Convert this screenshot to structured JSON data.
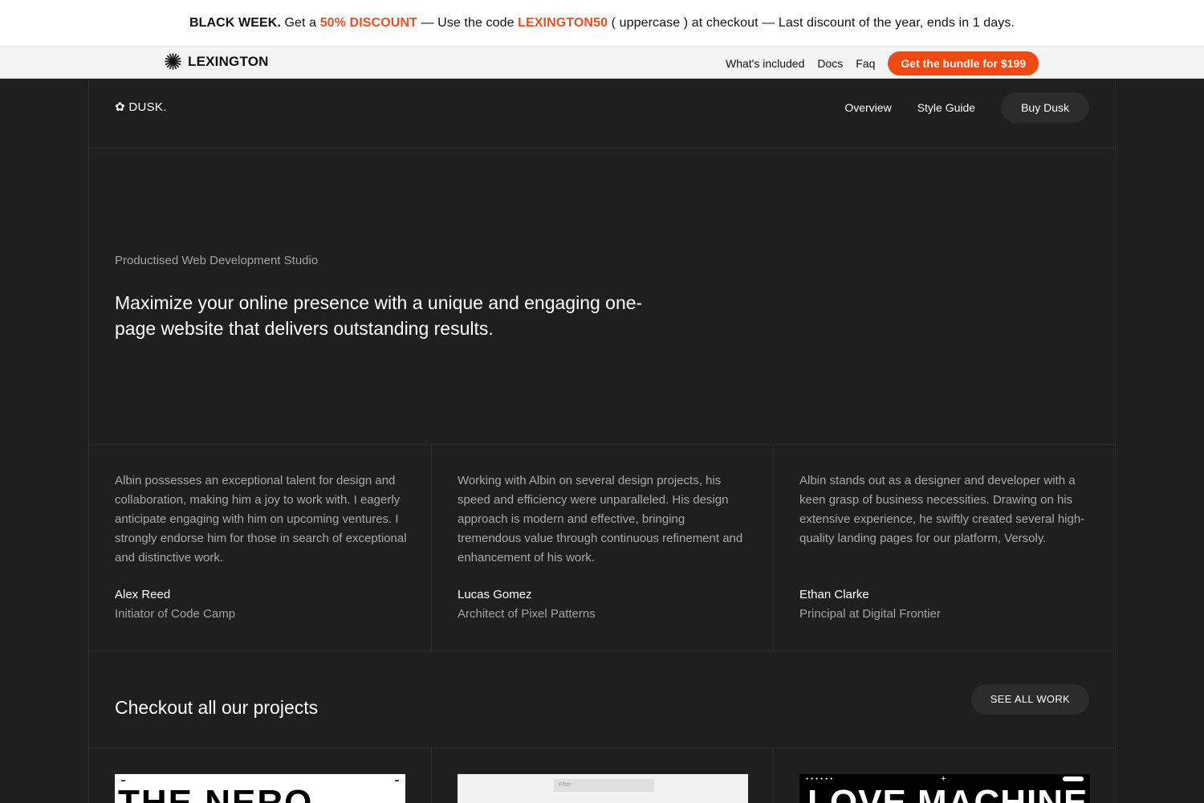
{
  "promo": {
    "lead": "BLACK WEEK.",
    "t1": " Get a ",
    "discount": "50% DISCOUNT",
    "t2": " — Use the code ",
    "code": "LEXINGTON50",
    "t3": " ( uppercase ) at checkout — Last discount of the year, ends in 1 days."
  },
  "lexbar": {
    "brand": "LEXINGTON",
    "links": [
      "What's included",
      "Docs",
      "Faq"
    ],
    "cta": "Get the bundle for $199"
  },
  "site_nav": {
    "logo": "✿ DUSK.",
    "links": [
      "Overview",
      "Style Guide"
    ],
    "buy": "Buy Dusk"
  },
  "hero": {
    "eyebrow": "Productised Web Development Studio",
    "title": "Maximize your online presence with a unique and engaging one-page website that delivers outstanding results."
  },
  "testimonials": [
    {
      "quote": "Albin possesses an exceptional talent for design and collaboration, making him a joy to work with. I eagerly anticipate engaging with him on upcoming ventures. I strongly endorse him for those in search of exceptional and distinctive work.",
      "name": "Alex Reed",
      "role": "Initiator of Code Camp"
    },
    {
      "quote": "Working with Albin on several design projects, his speed and efficiency were unparalleled. His design approach is modern and effective, bringing tremendous value through continuous refinement and enhancement of his work.",
      "name": "Lucas Gomez",
      "role": "Architect of Pixel Patterns"
    },
    {
      "quote": "Albin stands out as a designer and developer with a keen grasp of business necessities. Drawing on his extensive experience, he swiftly created several high-quality landing pages for our platform, Versoly.",
      "name": "Ethan Clarke",
      "role": "Principal at Digital Frontier"
    }
  ],
  "projects": {
    "title": "Checkout all our projects",
    "see_all": "SEE ALL WORK",
    "cards": [
      {
        "thumb_text": "THE NERO"
      },
      {
        "thumb_text": "Filter"
      },
      {
        "thumb_text": "LOVE MACHINE"
      }
    ]
  },
  "colors": {
    "accent": "#f04a12",
    "promo_highlight": "#e8501e",
    "dark_bg": "#1f1f1f"
  }
}
